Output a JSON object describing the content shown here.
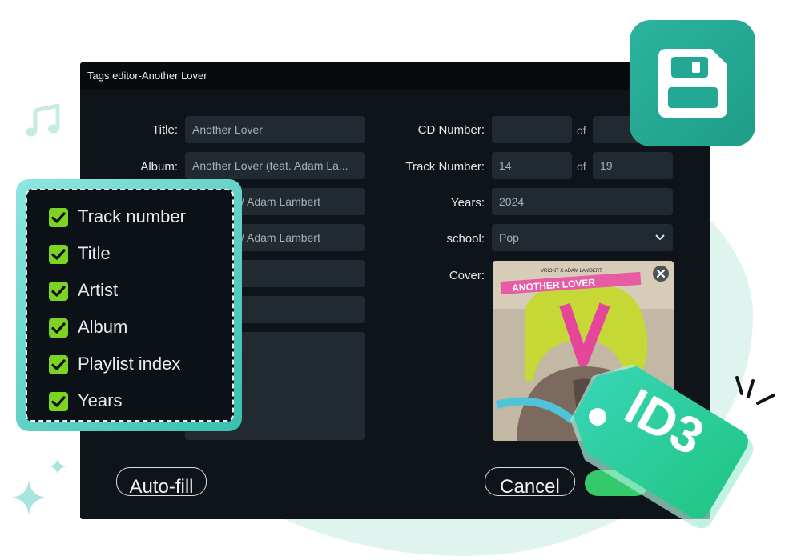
{
  "window": {
    "title": "Tags editor-Another Lover"
  },
  "left_fields": [
    {
      "label": "Title:",
      "value": "Another Lover"
    },
    {
      "label": "Album:",
      "value": "Another Lover (feat. Adam La..."
    },
    {
      "label": "",
      "value": "/ Adam Lambert"
    },
    {
      "label": "",
      "value": "/ Adam Lambert"
    }
  ],
  "right_fields": {
    "cd_number": {
      "label": "CD Number:",
      "value": "",
      "of_label": "of",
      "of_value": ""
    },
    "track_number": {
      "label": "Track Number:",
      "value": "14",
      "of_label": "of",
      "of_value": "19"
    },
    "years": {
      "label": "Years:",
      "value": "2024"
    },
    "school": {
      "label": "school:",
      "value": "Pop"
    },
    "cover": {
      "label": "Cover:",
      "art_top_text": "VRIONT X ADAM LAMBERT",
      "art_title": "ANOTHER LOVER"
    }
  },
  "buttons": {
    "autofill": "Auto-fill",
    "cancel": "Cancel"
  },
  "checklist": {
    "items": [
      {
        "label": "Track number",
        "checked": true
      },
      {
        "label": "Title",
        "checked": true
      },
      {
        "label": "Artist",
        "checked": true
      },
      {
        "label": "Album",
        "checked": true
      },
      {
        "label": "Playlist index",
        "checked": true
      },
      {
        "label": "Years",
        "checked": true
      }
    ]
  },
  "badge": {
    "text": "ID3"
  },
  "icons": {
    "save": "floppy-disk-icon",
    "music": "music-note-icon",
    "sparkle": "sparkle-icon",
    "close": "close-icon",
    "dropdown": "chevron-down-icon",
    "check": "checkmark-icon"
  },
  "colors": {
    "dialog_bg": "#0e1419",
    "field_bg": "#222a31",
    "accent_teal": "#2bb49f",
    "check_green": "#7cd321",
    "button_green": "#34c96a"
  }
}
